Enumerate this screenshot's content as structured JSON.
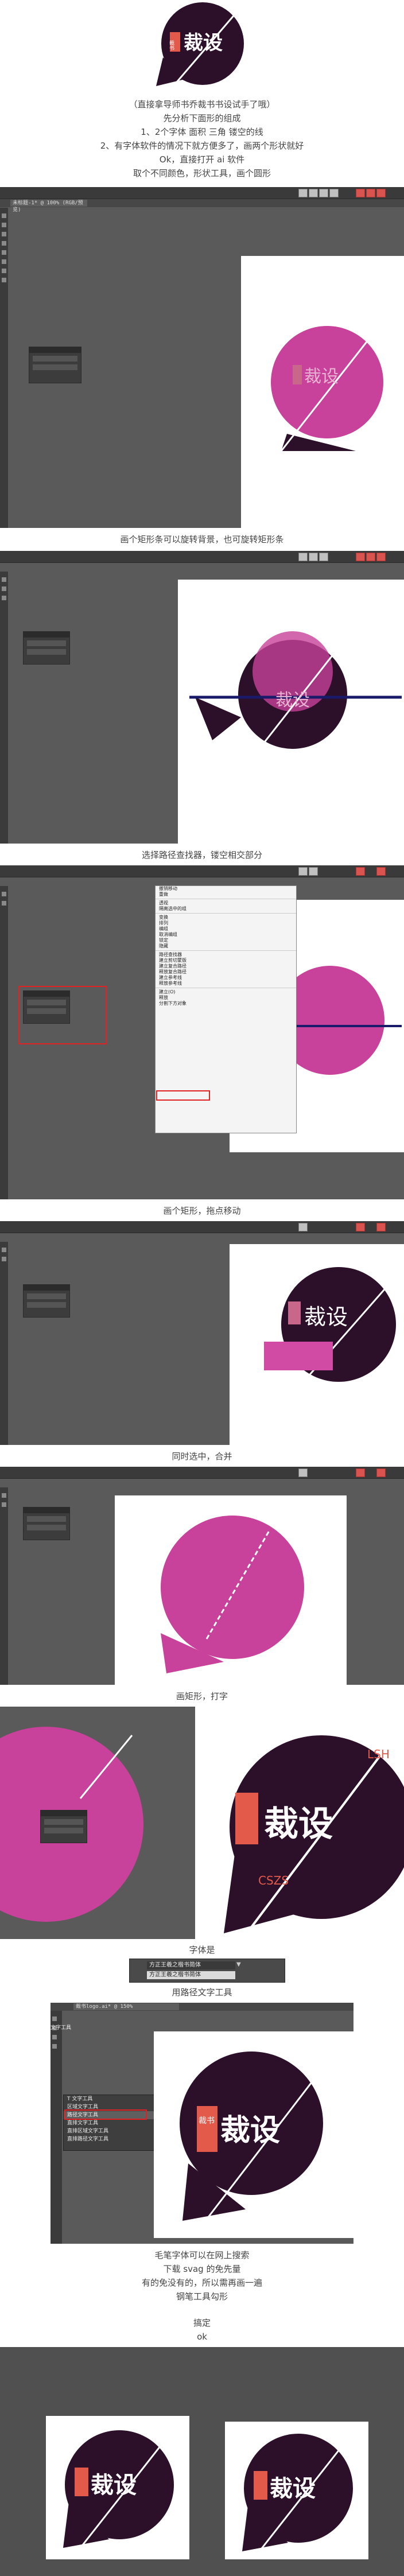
{
  "captions": {
    "intro_1": "（直接拿导师书乔裁书书设试手了哦）",
    "intro_2": "先分析下面形的组成",
    "intro_3": "1、2个字体 面积 三角 镂空的线",
    "intro_4": "2、有字体软件的情况下就方便多了，画两个形状就好",
    "intro_5": "Ok，直接打开 ai 软件",
    "intro_6": "取个不同颜色，形状工具，画个圆形",
    "step_rect_rotate": "画个矩形条可以旋转背景，也可旋转矩形条",
    "step_pathfinder": "选择路径查找器，镂空相交部分",
    "step_move": "画个矩形，拖点移动",
    "step_merge": "同时选中，合并",
    "step_type": "画矩形，打字",
    "step_type_2": "字体是",
    "step_text_tool": "用路径文字工具",
    "brush_1": "毛笔字体可以在网上搜索",
    "brush_2": "下载 svag 的免先量",
    "brush_3": "有的免没有的，所以需再画一遍",
    "brush_4": "钢笔工具勾形",
    "done_1": "搞定",
    "done_2": "ok"
  },
  "logo": {
    "main_text": "裁设",
    "seal_text": "裁书",
    "arc_text": "CSZS",
    "arc_text_2": "LSH"
  },
  "ui": {
    "file_tab": "未标题-1* @ 100% (RGB/预览)",
    "file_tab_2": "裁书logo.ai* @ 150%",
    "font_dropdown": "方正王羲之楷书简体",
    "font_dropdown_2": "方正王羲之楷书简体",
    "tools_title": "文字工具",
    "tools": [
      "T 文字工具",
      "区域文字工具",
      "路径文字工具",
      "直排文字工具",
      "直排区域文字工具",
      "直排路径文字工具"
    ],
    "context_menu": [
      "撤销移动",
      "重做",
      "透视",
      "隔离选中的组",
      "变换",
      "排列",
      "编组",
      "取消编组",
      "锁定",
      "隐藏",
      "路径查找器",
      "建立剪切蒙版",
      "建立复合路径",
      "释放复合路径",
      "建立参考线",
      "释放参考线",
      "建立(O)",
      "释放",
      "分割下方对象"
    ]
  },
  "colors": {
    "dark": "#2c0f29",
    "magenta": "#c8419a",
    "light_magenta": "#d14aa4",
    "salmon": "#e35a4b",
    "pinkish": "#c9678b",
    "ai_gray": "#5a5a5a"
  }
}
